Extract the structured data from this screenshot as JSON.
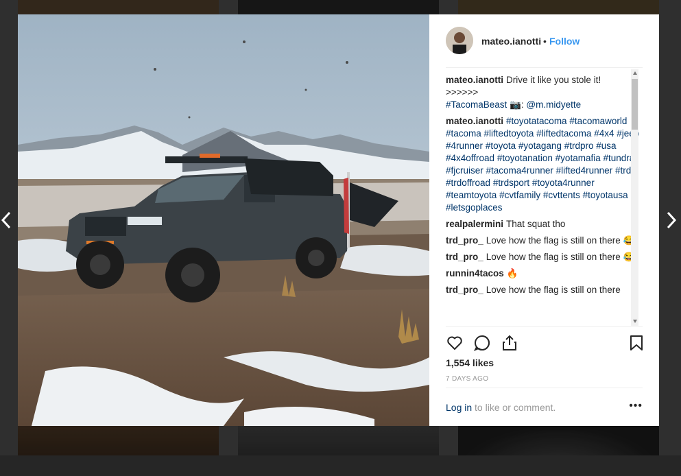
{
  "post": {
    "username": "mateo.ianotti",
    "separator": "•",
    "follow_label": "Follow",
    "likes": "1,554 likes",
    "time": "7 DAYS AGO",
    "login_link": "Log in",
    "login_rest": "to like or comment.",
    "more_label": "•••"
  },
  "comments": [
    {
      "user": "mateo.ianotti",
      "text": "Drive it like you stole it!",
      "lines": [
        ">>>>>>",
        "#TacomaBeast 📷: @m.midyette"
      ]
    },
    {
      "user": "mateo.ianotti",
      "text": "#toyotatacoma #tacomaworld #tacoma #liftedtoyota #liftedtacoma #4x4 #jeep #4runner #toyota #yotagang #trdpro #usa #4x4offroad #toyotanation #yotamafia #tundra #fjcruiser #tacoma4runner #lifted4runner #trd #trdoffroad #trdsport #toyota4runner #teamtoyota #cvtfamily #cvttents #toyotausa #letsgoplaces",
      "lines": []
    },
    {
      "user": "realpalermini",
      "text": "That squat tho",
      "lines": []
    },
    {
      "user": "trd_pro_",
      "text": "Love how the flag is still on there 😂",
      "lines": []
    },
    {
      "user": "trd_pro_",
      "text": "Love how the flag is still on there 😂",
      "lines": []
    },
    {
      "user": "runnin4tacos",
      "text": "🔥",
      "lines": []
    },
    {
      "user": "trd_pro_",
      "text": "Love how the flag is still on there",
      "lines": []
    }
  ],
  "icons": {
    "like": "heart-icon",
    "comment": "comment-icon",
    "share": "share-icon",
    "save": "bookmark-icon",
    "prev": "chevron-left-icon",
    "next": "chevron-right-icon"
  },
  "colors": {
    "link_blue": "#3897f0",
    "hashtag": "#003569",
    "muted": "#999999"
  }
}
